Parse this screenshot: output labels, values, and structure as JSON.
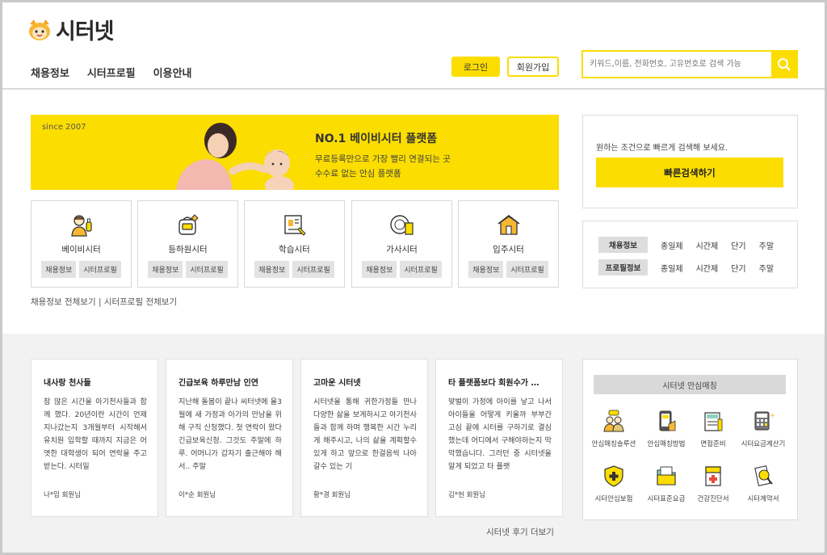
{
  "header": {
    "logo_text": "시터넷",
    "nav": [
      "채용정보",
      "시터프로필",
      "이용안내"
    ],
    "login_label": "로그인",
    "join_label": "회원가입",
    "search_placeholder": "키워드,이름, 전화번호, 고유번호로 검색 가능"
  },
  "banner": {
    "since": "since 2007",
    "title": "NO.1 베이비시터 플랫폼",
    "subtitle1": "무료등록만으로 가장 빨리 연결되는 곳",
    "subtitle2": "수수료 없는 안심 플랫폼"
  },
  "quick_search": {
    "label": "원하는 조건으로 빠르게 검색해 보세요.",
    "button": "빠른검색하기"
  },
  "categories": [
    {
      "name": "베이비시터",
      "icon": "babysitter-icon",
      "tags": [
        "채용정보",
        "시터프로필"
      ]
    },
    {
      "name": "등하원시터",
      "icon": "school-commute-icon",
      "tags": [
        "채용정보",
        "시터프로필"
      ]
    },
    {
      "name": "학습시터",
      "icon": "study-book-icon",
      "tags": [
        "채용정보",
        "시터프로필"
      ]
    },
    {
      "name": "가사시터",
      "icon": "housework-plate-icon",
      "tags": [
        "채용정보",
        "시터프로필"
      ]
    },
    {
      "name": "입주시터",
      "icon": "house-icon",
      "tags": [
        "채용정보",
        "시터프로필"
      ]
    }
  ],
  "view_all": "채용정보 전체보기 | 시터프로필 전체보기",
  "type_box": {
    "rows": [
      {
        "label": "채용정보",
        "items": [
          "종일제",
          "시간제",
          "단기",
          "주말"
        ]
      },
      {
        "label": "프로필정보",
        "items": [
          "종일제",
          "시간제",
          "단기",
          "주말"
        ]
      }
    ]
  },
  "reviews": [
    {
      "title": "내사랑 천사들",
      "body": "참 많은 시간을 아기천사들과 함께 했다. 20년이란 시간이 언제 지나갔는지 3개월부터 시작해서 유치원 입학할 때까지 지금은 어엿한 대학생이 되어 연락을 주고 받는다. 시터일",
      "author": "나*임 회원님"
    },
    {
      "title": "긴급보육 하루만남 인연",
      "body": "지난해 돌봄이 끝나 씨터넷에 올3월에 새 가정과 아가의 만남을 위해 구직 신청했다. 첫 연락이 왔다 긴급보육신청. 그것도 주말에 하루. 어머니가 갑자기 출근해야 해서.. 주말",
      "author": "이*순 회원님"
    },
    {
      "title": "고마운 시터넷",
      "body": "시터넷을 통해 귀한가정들 만나 다양한 삶을 보게하시고 아기천사들과 함께 하며 행복한 시간 누리게 해주시고, 나의 삶을 계획할수 있게 하고 앞으로 한걸음씩 나아갈수 있는 기",
      "author": "황*경 회원님"
    },
    {
      "title": "타 플랫폼보다 회원수가 …",
      "body": "맞벌이 가정에 아이를 낳고 나서 아이들을 어떻게 키울까 부부간 고심 끝에 시터를 구하기로 결심했는데 어디에서 구해야하는지 막막했습니다. 그러던 중 시터넷을 알게 되었고 타 플랫",
      "author": "김*헌 회원님"
    }
  ],
  "more_reviews": "시터넷 후기 더보기",
  "safe_matching": {
    "title": "시터넷 안심매칭",
    "items": [
      {
        "label": "안심매칭솔루션",
        "icon": "safe-matching-solution-icon"
      },
      {
        "label": "안심매칭방법",
        "icon": "phone-verify-icon"
      },
      {
        "label": "면접준비",
        "icon": "interview-book-icon"
      },
      {
        "label": "시터요금계산기",
        "icon": "calculator-icon"
      },
      {
        "label": "시터안심보험",
        "icon": "insurance-shield-icon"
      },
      {
        "label": "시터표준요금",
        "icon": "standard-fee-folder-icon"
      },
      {
        "label": "건강진단서",
        "icon": "health-certificate-icon"
      },
      {
        "label": "시터계약서",
        "icon": "contract-icon"
      }
    ]
  },
  "colors": {
    "accent": "#fbdd00",
    "page_bg": "#ffffff",
    "lower_bg": "#f2f2f2"
  }
}
